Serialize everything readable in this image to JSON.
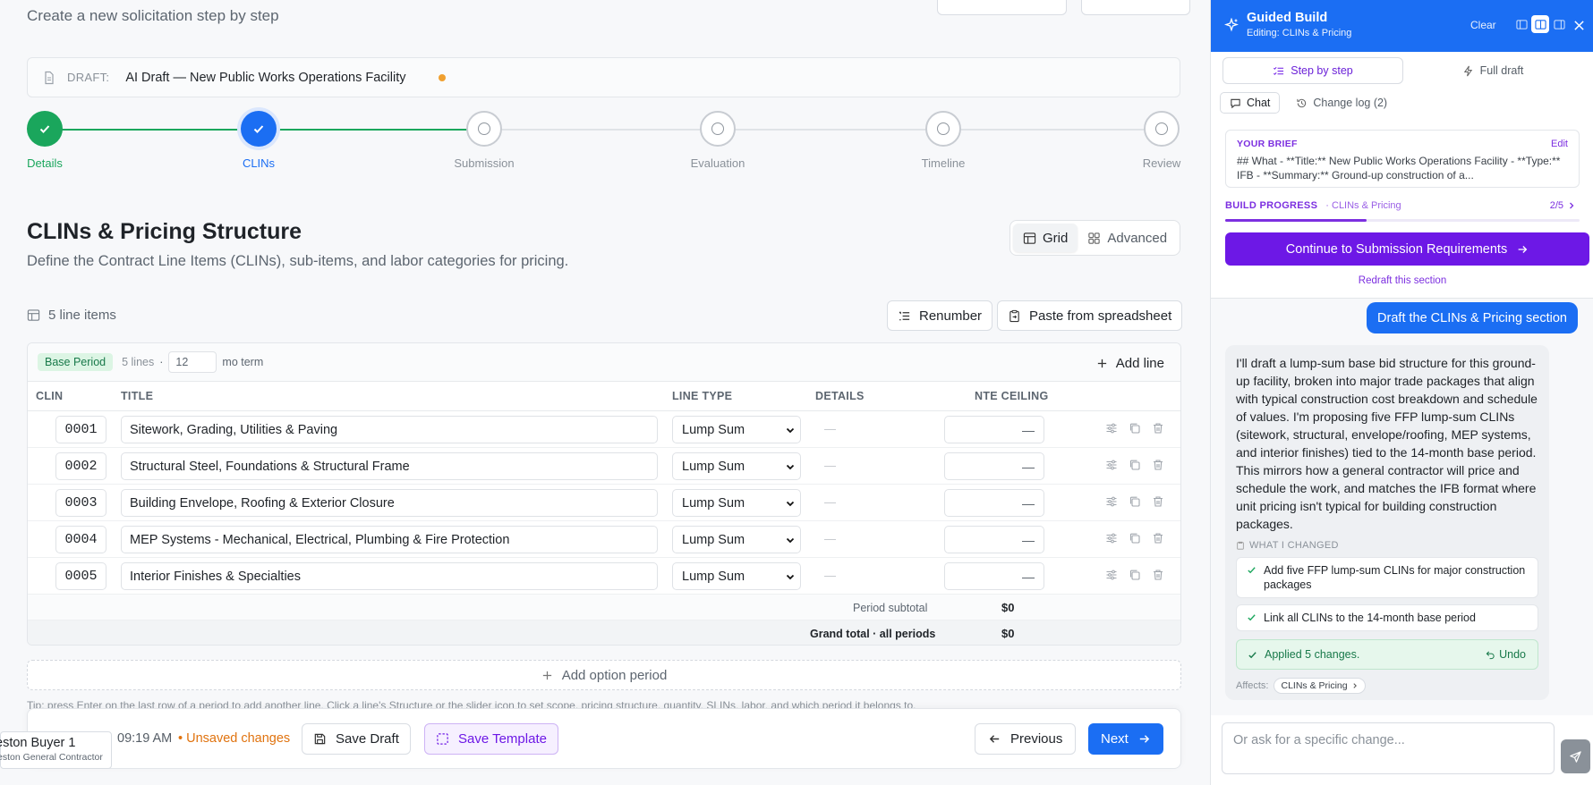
{
  "header": {
    "subtitle": "Create a new solicitation step by step"
  },
  "draft": {
    "label": "DRAFT:",
    "title": "AI Draft — New Public Works Operations Facility",
    "status_color": "#f0a030"
  },
  "stepper": {
    "steps": [
      {
        "label": "Details",
        "state": "done"
      },
      {
        "label": "CLINs",
        "state": "active"
      },
      {
        "label": "Submission",
        "state": "pending"
      },
      {
        "label": "Evaluation",
        "state": "pending"
      },
      {
        "label": "Timeline",
        "state": "pending"
      },
      {
        "label": "Review",
        "state": "pending"
      }
    ]
  },
  "section": {
    "title": "CLINs & Pricing Structure",
    "description": "Define the Contract Line Items (CLINs), sub-items, and labor categories for pricing.",
    "view_toggle": {
      "grid": "Grid",
      "advanced": "Advanced"
    }
  },
  "toolbar": {
    "line_count": "5 line items",
    "renumber": "Renumber",
    "paste": "Paste from spreadsheet"
  },
  "period": {
    "badge": "Base Period",
    "lines": "5 lines",
    "separator": "·",
    "term_value": "12",
    "term_unit": "mo term",
    "add_line": "Add line"
  },
  "table": {
    "headers": {
      "clin": "CLIN",
      "title": "TITLE",
      "line_type": "LINE TYPE",
      "details": "DETAILS",
      "nte": "NTE CEILING"
    },
    "rows": [
      {
        "clin": "0001",
        "title": "Sitework, Grading, Utilities & Paving",
        "type": "Lump Sum",
        "details": "—",
        "nte": "—"
      },
      {
        "clin": "0002",
        "title": "Structural Steel, Foundations & Structural Frame",
        "type": "Lump Sum",
        "details": "—",
        "nte": "—"
      },
      {
        "clin": "0003",
        "title": "Building Envelope, Roofing & Exterior Closure",
        "type": "Lump Sum",
        "details": "—",
        "nte": "—"
      },
      {
        "clin": "0004",
        "title": "MEP Systems - Mechanical, Electrical, Plumbing & Fire Protection",
        "type": "Lump Sum",
        "details": "—",
        "nte": "—"
      },
      {
        "clin": "0005",
        "title": "Interior Finishes & Specialties",
        "type": "Lump Sum",
        "details": "—",
        "nte": "—"
      }
    ],
    "subtotal_label": "Period subtotal",
    "subtotal_value": "$0",
    "grand_label": "Grand total · all periods",
    "grand_value": "$0"
  },
  "add_option": "Add option period",
  "tip": "Tip: press Enter on the last row of a period to add another line. Click a line's Structure or the slider icon to set scope, pricing structure, quantity, SLINs, labor, and which period it belongs to.",
  "footer": {
    "time": "09:19 AM",
    "unsaved": "• Unsaved changes",
    "save_draft": "Save Draft",
    "save_template": "Save Template",
    "previous": "Previous",
    "next": "Next"
  },
  "user": {
    "name": "eston Buyer 1",
    "org": "eston General Contractor"
  },
  "panel": {
    "title": "Guided Build",
    "subtitle": "Editing: CLINs & Pricing",
    "clear": "Clear",
    "modes": {
      "step": "Step by step",
      "full": "Full draft"
    },
    "tabs": {
      "chat": "Chat",
      "changelog": "Change log (2)"
    },
    "brief": {
      "label": "YOUR BRIEF",
      "edit": "Edit",
      "text": "## What - **Title:** New Public Works Operations Facility - **Type:** IFB - **Summary:** Ground-up construction of a..."
    },
    "progress": {
      "label": "BUILD PROGRESS",
      "section": "· CLINs & Pricing",
      "count": "2/5",
      "fraction": 0.4
    },
    "continue": "Continue to Submission Requirements",
    "redraft": "Redraft this section",
    "user_message": "Draft the CLINs & Pricing section",
    "ai_message": "I'll draft a lump-sum base bid structure for this ground-up facility, broken into major trade packages that align with typical construction cost breakdown and schedule of values. I'm proposing five FFP lump-sum CLINs (sitework, structural, envelope/roofing, MEP systems, and interior finishes) tied to the 14-month base period. This mirrors how a general contractor will price and schedule the work, and matches the IFB format where unit pricing isn't typical for building construction packages.",
    "what_changed": "WHAT I CHANGED",
    "changes": [
      "Add five FFP lump-sum CLINs for major construction packages",
      "Link all CLINs to the 14-month base period"
    ],
    "applied": "Applied 5 changes.",
    "undo": "Undo",
    "affects": "Affects:",
    "affects_chip": "CLINs & Pricing",
    "input_placeholder": "Or ask for a specific change..."
  },
  "colors": {
    "primary": "#1b6ef3",
    "done": "#1aa65c",
    "purple": "#6d18e6",
    "warning": "#e0730f"
  }
}
